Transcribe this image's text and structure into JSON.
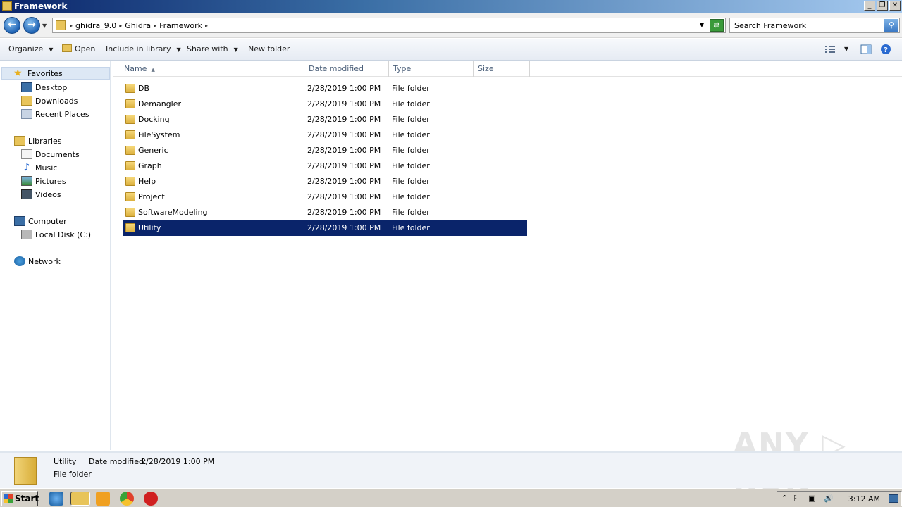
{
  "window": {
    "title": "Framework",
    "btn_min": "_",
    "btn_max": "❐",
    "btn_close": "✕"
  },
  "address": {
    "crumbs": [
      "ghidra_9.0",
      "Ghidra",
      "Framework"
    ],
    "search_placeholder": "Search Framework"
  },
  "commands": {
    "organize": "Organize",
    "open": "Open",
    "include_in_library": "Include in library",
    "share_with": "Share with",
    "new_folder": "New folder"
  },
  "nav": {
    "favorites": "Favorites",
    "desktop": "Desktop",
    "downloads": "Downloads",
    "recent_places": "Recent Places",
    "libraries": "Libraries",
    "documents": "Documents",
    "music": "Music",
    "pictures": "Pictures",
    "videos": "Videos",
    "computer": "Computer",
    "local_disk": "Local Disk (C:)",
    "network": "Network"
  },
  "columns": {
    "name": "Name",
    "date_modified": "Date modified",
    "type": "Type",
    "size": "Size"
  },
  "files": [
    {
      "name": "DB",
      "date": "2/28/2019 1:00 PM",
      "type": "File folder"
    },
    {
      "name": "Demangler",
      "date": "2/28/2019 1:00 PM",
      "type": "File folder"
    },
    {
      "name": "Docking",
      "date": "2/28/2019 1:00 PM",
      "type": "File folder"
    },
    {
      "name": "FileSystem",
      "date": "2/28/2019 1:00 PM",
      "type": "File folder"
    },
    {
      "name": "Generic",
      "date": "2/28/2019 1:00 PM",
      "type": "File folder"
    },
    {
      "name": "Graph",
      "date": "2/28/2019 1:00 PM",
      "type": "File folder"
    },
    {
      "name": "Help",
      "date": "2/28/2019 1:00 PM",
      "type": "File folder"
    },
    {
      "name": "Project",
      "date": "2/28/2019 1:00 PM",
      "type": "File folder"
    },
    {
      "name": "SoftwareModeling",
      "date": "2/28/2019 1:00 PM",
      "type": "File folder"
    },
    {
      "name": "Utility",
      "date": "2/28/2019 1:00 PM",
      "type": "File folder",
      "selected": true
    }
  ],
  "details": {
    "name": "Utility",
    "date_label": "Date modified:",
    "date_value": "2/28/2019 1:00 PM",
    "type": "File folder"
  },
  "watermark": "ANY RUN",
  "taskbar": {
    "start": "Start",
    "clock": "3:12 AM"
  },
  "colors": {
    "selection": "#0a246a",
    "titlebar": "#0a246a"
  }
}
